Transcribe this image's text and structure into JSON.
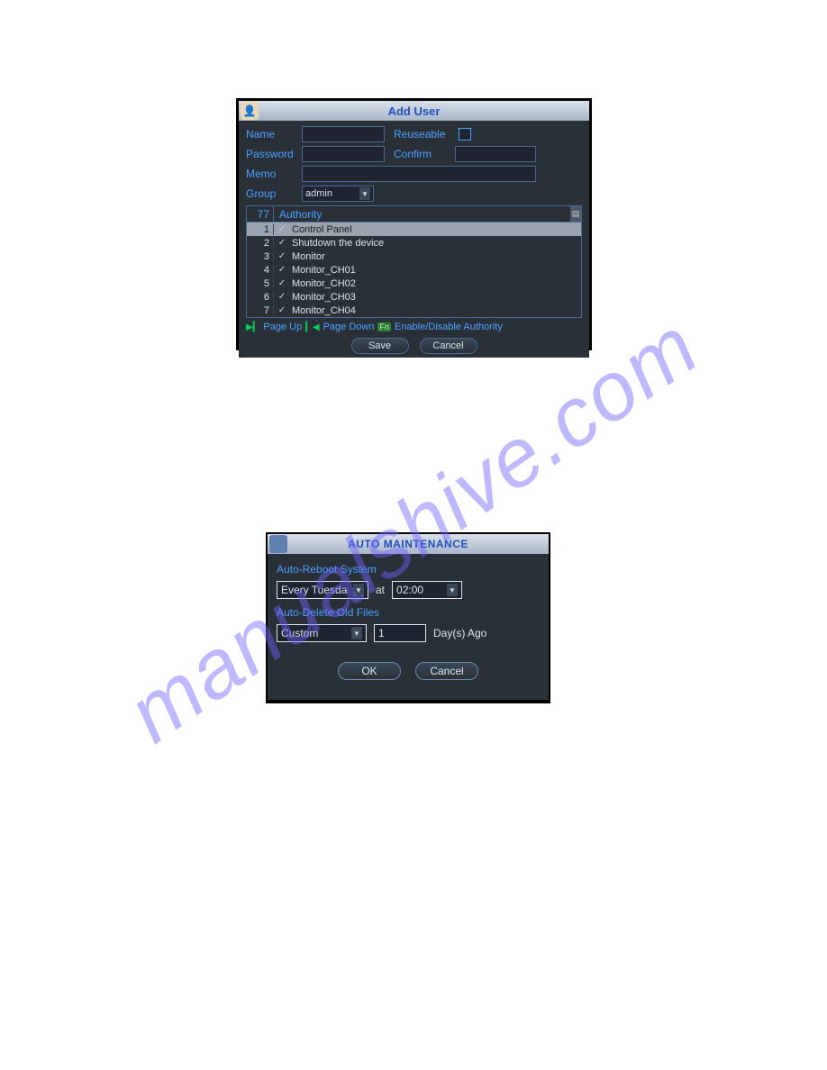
{
  "watermark_text": "manualshive.com",
  "dialog1": {
    "title": "Add User",
    "labels": {
      "name": "Name",
      "reuseable": "Reuseable",
      "password": "Password",
      "confirm": "Confirm",
      "memo": "Memo",
      "group": "Group"
    },
    "group_value": "admin",
    "authority": {
      "header_count": "77",
      "header_label": "Authority",
      "rows": [
        {
          "n": "1",
          "label": "Control Panel",
          "checked": true,
          "selected": true
        },
        {
          "n": "2",
          "label": "Shutdown the device",
          "checked": true,
          "selected": false
        },
        {
          "n": "3",
          "label": "Monitor",
          "checked": true,
          "selected": false
        },
        {
          "n": "4",
          "label": "Monitor_CH01",
          "checked": true,
          "selected": false
        },
        {
          "n": "5",
          "label": "Monitor_CH02",
          "checked": true,
          "selected": false
        },
        {
          "n": "6",
          "label": "Monitor_CH03",
          "checked": true,
          "selected": false
        },
        {
          "n": "7",
          "label": "Monitor_CH04",
          "checked": true,
          "selected": false
        }
      ]
    },
    "pager": {
      "page_up": "Page Up",
      "page_down": "Page Down",
      "fn": "Fn",
      "enable_disable": "Enable/Disable Authority"
    },
    "buttons": {
      "save": "Save",
      "cancel": "Cancel"
    }
  },
  "dialog2": {
    "title": "AUTO MAINTENANCE",
    "section_reboot": "Auto-Reboot System",
    "reboot_day": "Every Tuesda",
    "at": "at",
    "reboot_time": "02:00",
    "section_delete": "Auto-Delete Old Files",
    "delete_mode": "Custom",
    "delete_days": "1",
    "days_ago": "Day(s) Ago",
    "buttons": {
      "ok": "OK",
      "cancel": "Cancel"
    }
  }
}
